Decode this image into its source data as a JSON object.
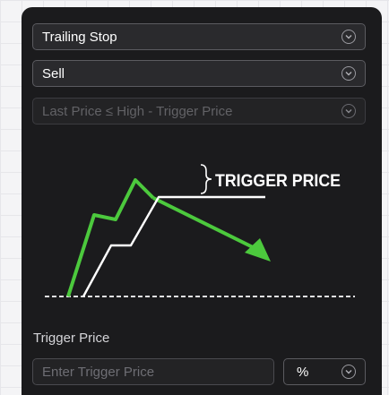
{
  "order_type": {
    "value": "Trailing Stop"
  },
  "side": {
    "value": "Sell"
  },
  "condition": {
    "value": "Last Price ≤ High - Trigger Price"
  },
  "diagram": {
    "annotation": "TRIGGER PRICE",
    "price_line_color": "#4cc93d",
    "stop_line_color": "#ffffff"
  },
  "trigger_price": {
    "label": "Trigger Price",
    "placeholder": "Enter Trigger Price",
    "value": "",
    "unit": "%"
  },
  "icons": {
    "dropdown": "chevron-down-circle-icon"
  }
}
